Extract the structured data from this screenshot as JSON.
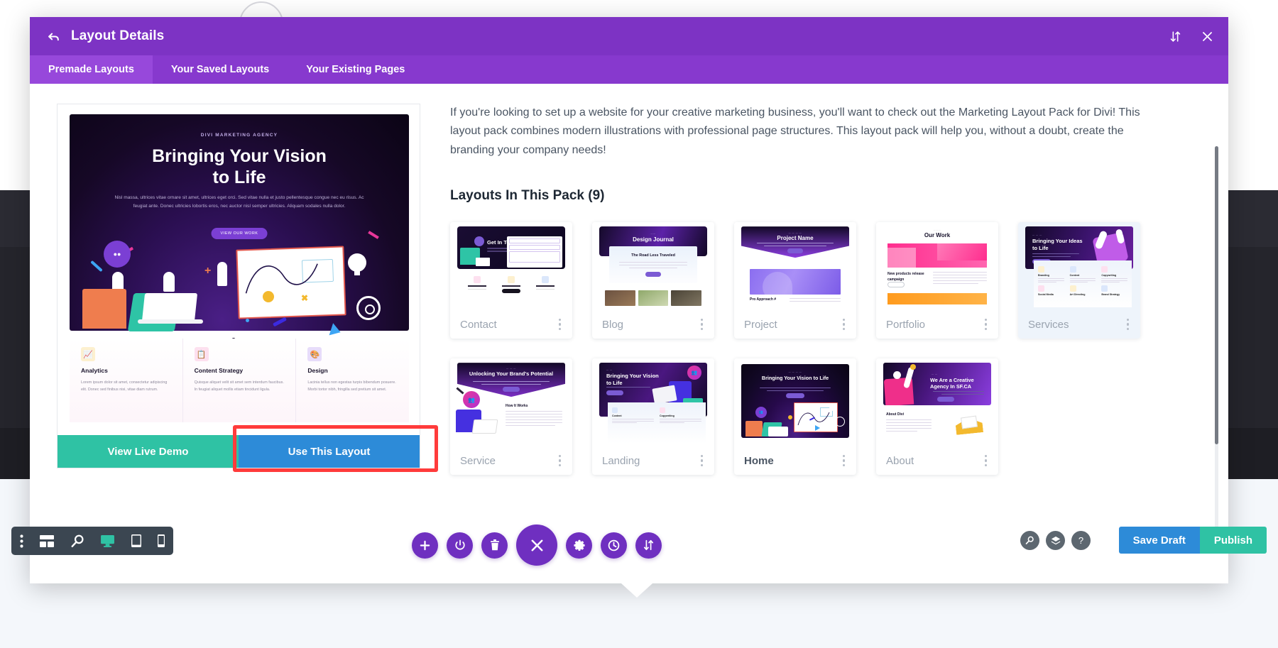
{
  "modal": {
    "title": "Layout Details",
    "back_icon": "back-arrow-icon",
    "sort_icon": "sort-updown-icon",
    "close_icon": "close-icon",
    "tabs": [
      {
        "label": "Premade Layouts",
        "active": true
      },
      {
        "label": "Your Saved Layouts",
        "active": false
      },
      {
        "label": "Your Existing Pages",
        "active": false
      }
    ]
  },
  "preview": {
    "hero": {
      "eyebrow": "DIVI MARKETING AGENCY",
      "title_line1": "Bringing Your Vision",
      "title_line2": "to Life",
      "subtext": "Nisl massa, ultrices vitae ornare sit amet, ultrices eget orci. Sed vitae nulla et justo pellentesque congue nec eu risus. Ac feugiat ante. Donec ultricies lobortis eros, nec auctor nisl semper ultricies. Aliquam sodales nulla dolor.",
      "button": "VIEW OUR WORK"
    },
    "features": [
      {
        "title": "Analytics",
        "body": "Lorem ipsum dolor sit amet, consectetur adipiscing elit. Donec sed finibus nisi, vitae diam rutrum.",
        "icon": "chart-icon",
        "color": "#f3b92e"
      },
      {
        "title": "Content Strategy",
        "body": "Quisque aliquet velit sit amet sem interdum faucibus. In feugiat aliquet mollis etiam tincidunt ligula.",
        "icon": "clipboard-icon",
        "color": "#e8379a"
      },
      {
        "title": "Design",
        "body": "Lacinia tellus non egestas turpis bibendum posuere. Morbi tortor nibh, fringilla sed pretium sit amet.",
        "icon": "palette-icon",
        "color": "#6f2fc0"
      }
    ],
    "view_demo_label": "View Live Demo",
    "use_layout_label": "Use This Layout"
  },
  "content": {
    "description": "If you're looking to set up a website for your creative marketing business, you'll want to check out the Marketing Layout Pack for Divi! This layout pack combines modern illustrations with professional page structures. This layout pack will help you, without a doubt, create the branding your company needs!",
    "pack_heading": "Layouts In This Pack (9)",
    "layouts": [
      {
        "name": "Contact",
        "thumb_title": "Get In Touch",
        "style": "contact",
        "state": "normal"
      },
      {
        "name": "Blog",
        "thumb_title": "Design Journal",
        "style": "blog",
        "state": "normal",
        "thumb_sub": "The Road Less Traveled"
      },
      {
        "name": "Project",
        "thumb_title": "Project Name",
        "style": "project",
        "state": "normal"
      },
      {
        "name": "Portfolio",
        "thumb_title": "Our Work",
        "style": "portfolio",
        "state": "normal",
        "thumb_sub": "New products release campaign"
      },
      {
        "name": "Services",
        "thumb_title": "Bringing Your Ideas to Life",
        "style": "services",
        "state": "highlight"
      },
      {
        "name": "Service",
        "thumb_title": "Unlocking Your Brand's Potential",
        "style": "service",
        "state": "normal",
        "thumb_sub": "How It Works"
      },
      {
        "name": "Landing",
        "thumb_title": "Bringing Your Vision to Life",
        "style": "landing",
        "state": "normal"
      },
      {
        "name": "Home",
        "thumb_title": "Bringing Your Vision to Life",
        "style": "home",
        "state": "active"
      },
      {
        "name": "About",
        "thumb_title": "We Are a Creative Agency In SF.CA",
        "style": "about",
        "state": "normal",
        "thumb_sub": "About Divi"
      }
    ]
  },
  "editor_bar": {
    "left_tools": [
      {
        "name": "more-options-icon",
        "glyph": "kebab"
      },
      {
        "name": "wireframe-icon",
        "glyph": "wireframe"
      },
      {
        "name": "zoom-icon",
        "glyph": "magnifier"
      },
      {
        "name": "desktop-view-icon",
        "glyph": "desktop",
        "active": true
      },
      {
        "name": "tablet-view-icon",
        "glyph": "tablet"
      },
      {
        "name": "phone-view-icon",
        "glyph": "phone"
      }
    ],
    "center_tools": [
      {
        "name": "add-section-button",
        "glyph": "plus"
      },
      {
        "name": "toggle-builder-button",
        "glyph": "power"
      },
      {
        "name": "trash-button",
        "glyph": "trash"
      },
      {
        "name": "close-menu-button",
        "glyph": "close",
        "big": true
      },
      {
        "name": "settings-button",
        "glyph": "gear"
      },
      {
        "name": "history-button",
        "glyph": "clock"
      },
      {
        "name": "portability-button",
        "glyph": "updown"
      }
    ],
    "right_tools": [
      {
        "name": "search-icon",
        "glyph": "magnifier"
      },
      {
        "name": "layers-icon",
        "glyph": "layers"
      },
      {
        "name": "help-icon",
        "glyph": "question"
      }
    ],
    "save_draft_label": "Save Draft",
    "publish_label": "Publish"
  },
  "colors": {
    "modal_header": "#7D33C4",
    "tab_bar": "#8739CE",
    "tab_active": "#9748DB",
    "teal": "#2fc2a4",
    "blue": "#2d8bd8",
    "highlight_red": "#ff3b3b",
    "purple": "#6f2fc0"
  }
}
